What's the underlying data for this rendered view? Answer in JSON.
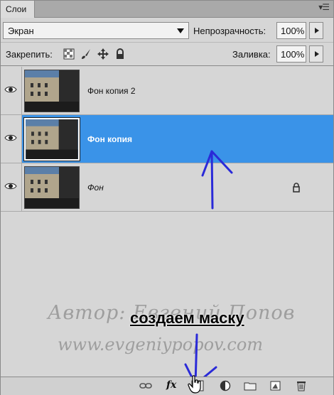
{
  "panel": {
    "tab_title": "Слои",
    "menu_glyph": "▾☰"
  },
  "blend": {
    "mode": "Экран",
    "opacity_label": "Непрозрачность:",
    "opacity_value": "100%"
  },
  "lock": {
    "label": "Закрепить:",
    "fill_label": "Заливка:",
    "fill_value": "100%",
    "icons": [
      "lock-transparent-pixels-icon",
      "lock-image-pixels-icon",
      "lock-position-icon",
      "lock-all-icon"
    ]
  },
  "layers": [
    {
      "name": "Фон копия 2",
      "visible": true,
      "selected": false,
      "locked": false
    },
    {
      "name": "Фон копия",
      "visible": true,
      "selected": true,
      "locked": false
    },
    {
      "name": "Фон",
      "visible": true,
      "selected": false,
      "locked": true
    }
  ],
  "overlay": {
    "caption": "создаем маску",
    "watermark_line1": "Автор: Евгений Попов",
    "watermark_line2": "www.evgeniypopov.com"
  },
  "bottom_bar": {
    "icons": [
      "link-layers-icon",
      "layer-style-fx-icon",
      "add-mask-icon",
      "adjustment-layer-icon",
      "new-group-folder-icon",
      "new-layer-icon",
      "trash-icon"
    ],
    "fx_label": "fx"
  },
  "colors": {
    "selection": "#3a93e8",
    "annotation_arrow": "#2a2ad8"
  }
}
